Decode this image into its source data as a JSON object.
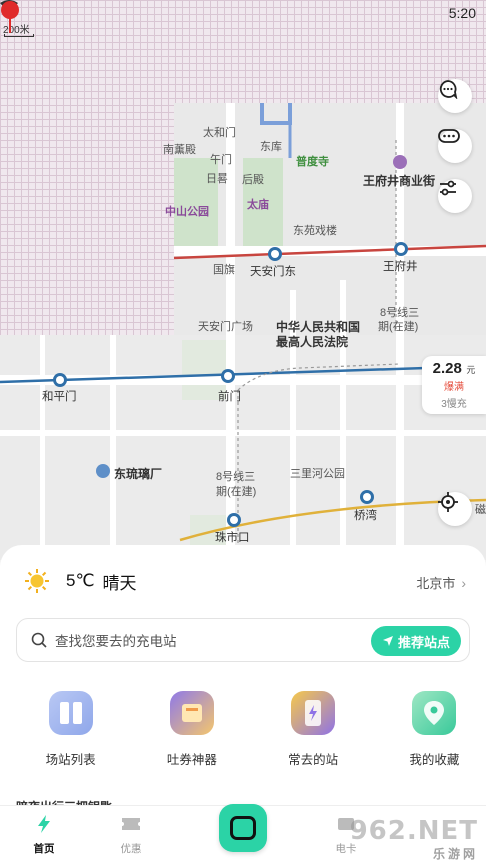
{
  "status_bar": {
    "time": "5:20"
  },
  "map": {
    "scale": "200米",
    "labels": {
      "taihemen": "太和门",
      "nanxundian": "南薰殿",
      "dongku": "东库",
      "wumen": "午门",
      "pududa": "普度寺",
      "wangfujing_mall": "王府井商业街",
      "rijiu": "日晷",
      "houdian": "后殿",
      "zhongshan_park": "中山公园",
      "taimiao": "太庙",
      "dongyuan": "东苑戏楼",
      "guoqi": "国旗",
      "tiananmen_east": "天安门东",
      "wangfujing": "王府井",
      "tiananmen_square": "天安门广场",
      "supreme_court_1": "中华人民共和国",
      "supreme_court_2": "最高人民法院",
      "line8_1": "8号线三",
      "line8_2": "期(在建)",
      "hepingmen": "和平门",
      "qianmen": "前门",
      "dongliulichang": "东琉璃厂",
      "line8b_1": "8号线三",
      "line8b_2": "期(在建)",
      "sanlihe": "三里河公园",
      "qiaowan": "桥湾",
      "zhushikou": "珠市口",
      "edge": "磁"
    }
  },
  "price_card": {
    "price": "2.28",
    "unit": "元",
    "status": "爆满",
    "count": "3慢充"
  },
  "weather": {
    "temp": "5℃",
    "condition": "晴天",
    "city": "北京市"
  },
  "search": {
    "placeholder": "查找您要去的充电站",
    "recommend_label": "推荐站点"
  },
  "shortcuts": [
    {
      "label": "场站列表"
    },
    {
      "label": "吐券神器"
    },
    {
      "label": "常去的站"
    },
    {
      "label": "我的收藏"
    }
  ],
  "peek_text": "暗夜出行三把钥匙",
  "tabbar": {
    "home": "首页",
    "coupon": "优惠",
    "charge": "电卡",
    "watermark": "962.NET",
    "watermark_sub": "乐游网"
  }
}
